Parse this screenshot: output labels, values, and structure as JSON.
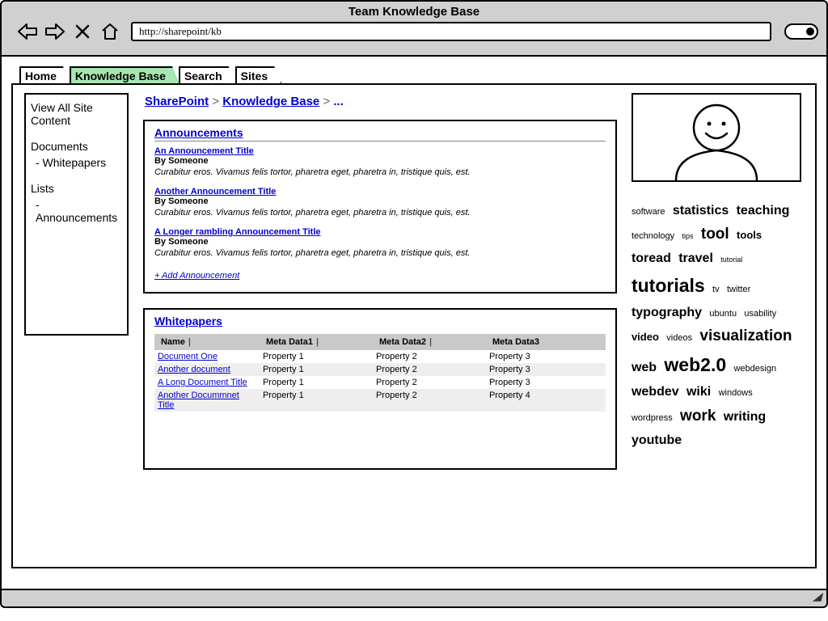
{
  "window": {
    "title": "Team Knowledge Base"
  },
  "url": "http://sharepoint/kb",
  "tabs": [
    {
      "label": "Home",
      "active": false
    },
    {
      "label": "Knowledge Base",
      "active": true
    },
    {
      "label": "Search",
      "active": false
    },
    {
      "label": "Sites",
      "active": false
    }
  ],
  "sidebar": {
    "view_all": "View All Site Content",
    "docs_header": "Documents",
    "docs_item": "- Whitepapers",
    "lists_header": "Lists",
    "lists_item": "- Announcements"
  },
  "breadcrumb": {
    "part1": "SharePoint",
    "part2": "Knowledge Base",
    "tail": "..."
  },
  "announcements": {
    "title": "Announcements",
    "items": [
      {
        "title": "An Announcement Title",
        "by": "By Someone",
        "body": "Curabitur eros. Vivamus felis tortor, pharetra eget, pharetra in, tristique quis, est."
      },
      {
        "title": "Another Announcement Title",
        "by": "By Someone",
        "body": "Curabitur eros. Vivamus felis tortor, pharetra eget, pharetra in, tristique quis, est."
      },
      {
        "title": "A Longer rambling Announcement Title",
        "by": "By Someone",
        "body": "Curabitur eros. Vivamus felis tortor, pharetra eget, pharetra in, tristique quis, est."
      }
    ],
    "add": "+ Add Announcement"
  },
  "whitepapers": {
    "title": "Whitepapers",
    "headers": [
      "Name",
      "Meta Data1",
      "Meta Data2",
      "Meta Data3"
    ],
    "rows": [
      {
        "name": "Document One",
        "c1": "Property 1",
        "c2": "Property 2",
        "c3": "Property 3"
      },
      {
        "name": "Another document",
        "c1": "Property 1",
        "c2": "Property 2",
        "c3": "Property 3"
      },
      {
        "name": "A Long Document Title",
        "c1": "Property 1",
        "c2": "Property 2",
        "c3": "Property 3"
      },
      {
        "name": "Another Docummnet Title",
        "c1": "Property 1",
        "c2": "Property 2",
        "c3": "Property 4"
      }
    ]
  },
  "tags": [
    {
      "t": "software",
      "s": "t1"
    },
    {
      "t": "statistics",
      "s": "t3"
    },
    {
      "t": "teaching",
      "s": "t3"
    },
    {
      "t": "technology",
      "s": "t1"
    },
    {
      "t": "tips",
      "s": "tiny"
    },
    {
      "t": "tool",
      "s": "t4"
    },
    {
      "t": "tools",
      "s": "t2"
    },
    {
      "t": "toread",
      "s": "t3"
    },
    {
      "t": "travel",
      "s": "t3"
    },
    {
      "t": "tutorial",
      "s": "tiny"
    },
    {
      "t": "tutorials",
      "s": "t5"
    },
    {
      "t": "tv",
      "s": "t1"
    },
    {
      "t": "twitter",
      "s": "t1"
    },
    {
      "t": "typography",
      "s": "t3"
    },
    {
      "t": "ubuntu",
      "s": "t1"
    },
    {
      "t": "usability",
      "s": "t1"
    },
    {
      "t": "video",
      "s": "t2"
    },
    {
      "t": "videos",
      "s": "t1"
    },
    {
      "t": "visualization",
      "s": "t4"
    },
    {
      "t": "web",
      "s": "t3"
    },
    {
      "t": "web2.0",
      "s": "t5"
    },
    {
      "t": "webdesign",
      "s": "t1"
    },
    {
      "t": "webdev",
      "s": "t3"
    },
    {
      "t": "wiki",
      "s": "t3"
    },
    {
      "t": "windows",
      "s": "t1"
    },
    {
      "t": "wordpress",
      "s": "t1"
    },
    {
      "t": "work",
      "s": "t4"
    },
    {
      "t": "writing",
      "s": "t3"
    },
    {
      "t": "youtube",
      "s": "t3"
    }
  ]
}
